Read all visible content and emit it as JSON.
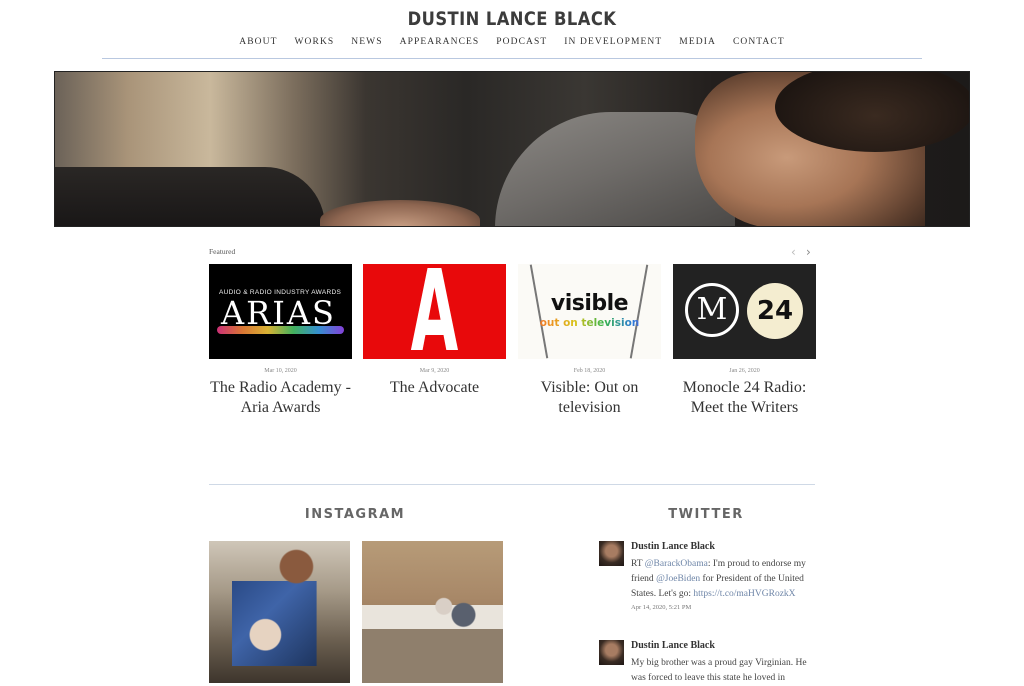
{
  "site": {
    "title": "DUSTIN LANCE BLACK"
  },
  "nav": [
    "ABOUT",
    "WORKS",
    "NEWS",
    "APPEARANCES",
    "PODCAST",
    "IN DEVELOPMENT",
    "MEDIA",
    "CONTACT"
  ],
  "featured": {
    "label": "Featured",
    "prev_icon": "‹",
    "next_icon": "›",
    "cards": [
      {
        "date": "Mar 10, 2020",
        "title": "The Radio Academy - Aria Awards",
        "thumb": {
          "sub": "AUDIO & RADIO INDUSTRY AWARDS",
          "big": "ARIAS"
        }
      },
      {
        "date": "Mar 9, 2020",
        "title": "The Advocate",
        "thumb": {
          "big": "A"
        }
      },
      {
        "date": "Feb 18, 2020",
        "title": "Visible: Out on television",
        "thumb": {
          "big": "visible",
          "sub": "out on television"
        }
      },
      {
        "date": "Jan 26, 2020",
        "title": "Monocle 24 Radio: Meet the Writers",
        "thumb": {
          "ring": "M",
          "badge": "24"
        }
      }
    ]
  },
  "instagram": {
    "heading": "INSTAGRAM"
  },
  "twitter": {
    "heading": "TWITTER",
    "tweets": [
      {
        "name": "Dustin Lance Black",
        "parts": [
          "RT ",
          "@BarackObama",
          ": I'm proud to endorse my friend ",
          "@JoeBiden",
          " for President of the United States. Let's go: ",
          "https://t.co/maHVGRozkX"
        ],
        "time": "Apr 14, 2020, 5:21 PM"
      },
      {
        "name": "Dustin Lance Black",
        "text": "My big brother was a proud gay Virginian. He was forced to leave this state he loved in"
      }
    ]
  },
  "colors": {
    "accent_rule": "#b9c8e0",
    "advocate_red": "#e8090b",
    "link": "#6f86a8"
  }
}
